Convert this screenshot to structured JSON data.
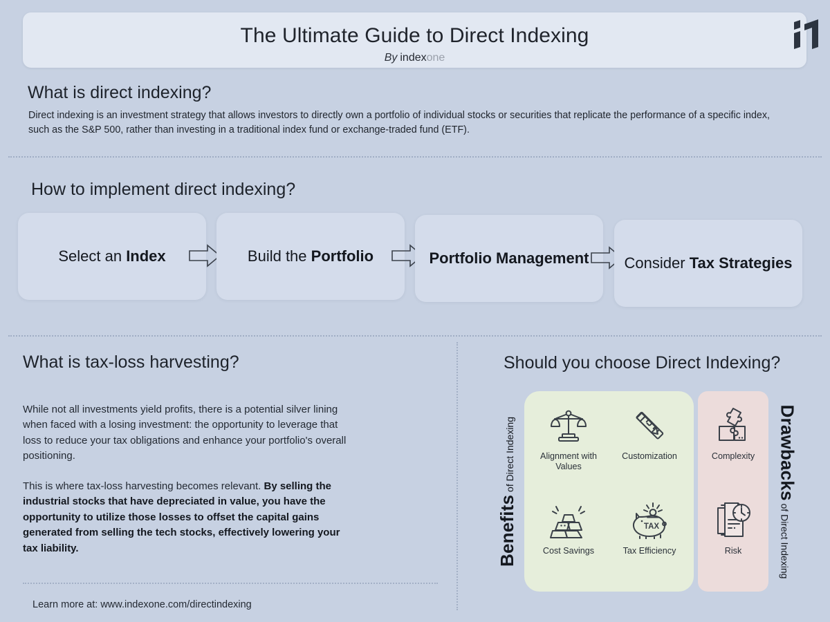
{
  "header": {
    "title": "The Ultimate Guide to Direct Indexing",
    "by_label": "By",
    "brand_first": "index",
    "brand_second": "one",
    "logo_name": "indexone-i1-logo"
  },
  "section_what": {
    "title": "What is direct indexing?",
    "body": "Direct indexing is an investment strategy that allows investors to directly own a portfolio of individual stocks or securities that replicate the performance of a specific index, such as the S&P 500, rather than investing in a traditional index fund or exchange-traded fund (ETF)."
  },
  "section_how": {
    "title": "How to implement direct indexing?",
    "steps": [
      {
        "prefix": "Select an ",
        "strong": "Index",
        "suffix": ""
      },
      {
        "prefix": "Build the ",
        "strong": "Portfolio",
        "suffix": ""
      },
      {
        "prefix": "",
        "strong": "Portfolio Management",
        "suffix": ""
      },
      {
        "prefix": "Consider ",
        "strong": "Tax Strategies",
        "suffix": ""
      }
    ],
    "arrow_icon": "arrow-right-icon"
  },
  "section_tlh": {
    "title": "What is tax-loss harvesting?",
    "paragraph1": "While not all investments yield profits, there is a potential silver lining when faced with a losing investment: the opportunity to leverage that loss to reduce your tax obligations and enhance your portfolio's overall positioning.",
    "paragraph2_plain": "This is where tax-loss harvesting becomes relevant. ",
    "paragraph2_bold": "By selling the industrial stocks that have depreciated in value, you have the opportunity to utilize those losses to offset the capital gains generated from selling the tech stocks, effectively lowering your tax liability.",
    "learn_more": "Learn more at: www.indexone.com/directindexing"
  },
  "section_choose": {
    "title": "Should you choose Direct Indexing?",
    "benefits_label_big": "Benefits",
    "benefits_label_small": " of Direct Indexing",
    "drawbacks_label_big": "Drawbacks",
    "drawbacks_label_small": " of Direct Indexing",
    "benefits_color": "#e6eedb",
    "drawbacks_color": "#ecdcdb",
    "benefits": [
      {
        "label": "Alignment with Values",
        "icon": "balance-scale-icon"
      },
      {
        "label": "Customization",
        "icon": "ruler-pencil-icon"
      },
      {
        "label": "Cost Savings",
        "icon": "gold-bars-icon"
      },
      {
        "label": "Tax Efficiency",
        "icon": "piggy-bank-tax-icon"
      }
    ],
    "drawbacks": [
      {
        "label": "Complexity",
        "icon": "puzzle-pieces-icon"
      },
      {
        "label": "Risk",
        "icon": "document-clock-icon"
      }
    ]
  },
  "theme": {
    "background": "#c7d1e2",
    "header_bg": "#e2e8f2",
    "card_bg": "#d4dceb",
    "ink": "#1b2029"
  }
}
